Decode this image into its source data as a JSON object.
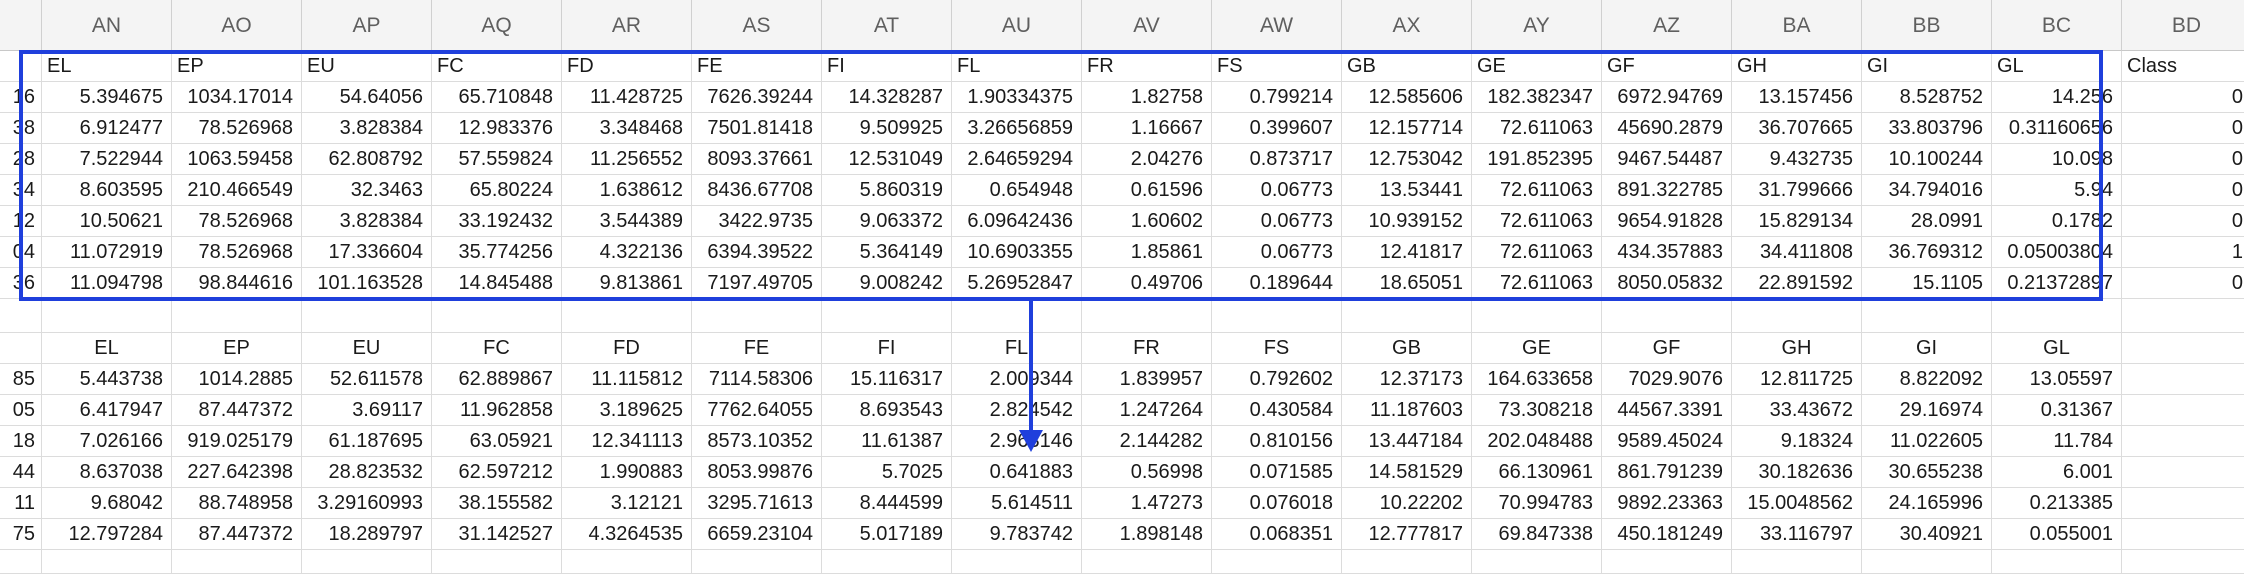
{
  "columns": [
    "AN",
    "AO",
    "AP",
    "AQ",
    "AR",
    "AS",
    "AT",
    "AU",
    "AV",
    "AW",
    "AX",
    "AY",
    "AZ",
    "BA",
    "BB",
    "BC",
    "BD"
  ],
  "top_table": {
    "headers": [
      "EL",
      "EP",
      "EU",
      "FC",
      "FD",
      "FE",
      "FI",
      "FL",
      "FR",
      "FS",
      "GB",
      "GE",
      "GF",
      "GH",
      "GI",
      "GL",
      "Class"
    ],
    "row_numbers": [
      "16",
      "38",
      "28",
      "34",
      "12",
      "04",
      "36"
    ],
    "rows": [
      [
        "5.394675",
        "1034.17014",
        "54.64056",
        "65.710848",
        "11.428725",
        "7626.39244",
        "14.328287",
        "1.90334375",
        "1.82758",
        "0.799214",
        "12.585606",
        "182.382347",
        "6972.94769",
        "13.157456",
        "8.528752",
        "14.256",
        "0"
      ],
      [
        "6.912477",
        "78.526968",
        "3.828384",
        "12.983376",
        "3.348468",
        "7501.81418",
        "9.509925",
        "3.26656859",
        "1.16667",
        "0.399607",
        "12.157714",
        "72.611063",
        "45690.2879",
        "36.707665",
        "33.803796",
        "0.31160656",
        "0"
      ],
      [
        "7.522944",
        "1063.59458",
        "62.808792",
        "57.559824",
        "11.256552",
        "8093.37661",
        "12.531049",
        "2.64659294",
        "2.04276",
        "0.873717",
        "12.753042",
        "191.852395",
        "9467.54487",
        "9.432735",
        "10.100244",
        "10.098",
        "0"
      ],
      [
        "8.603595",
        "210.466549",
        "32.3463",
        "65.80224",
        "1.638612",
        "8436.67708",
        "5.860319",
        "0.654948",
        "0.61596",
        "0.06773",
        "13.53441",
        "72.611063",
        "891.322785",
        "31.799666",
        "34.794016",
        "5.94",
        "0"
      ],
      [
        "10.50621",
        "78.526968",
        "3.828384",
        "33.192432",
        "3.544389",
        "3422.9735",
        "9.063372",
        "6.09642436",
        "1.60602",
        "0.06773",
        "10.939152",
        "72.611063",
        "9654.91828",
        "15.829134",
        "28.0991",
        "0.1782",
        "0"
      ],
      [
        "11.072919",
        "78.526968",
        "17.336604",
        "35.774256",
        "4.322136",
        "6394.39522",
        "5.364149",
        "10.6903355",
        "1.85861",
        "0.06773",
        "12.41817",
        "72.611063",
        "434.357883",
        "34.411808",
        "36.769312",
        "0.05003804",
        "1"
      ],
      [
        "11.094798",
        "98.844616",
        "101.163528",
        "14.845488",
        "9.813861",
        "7197.49705",
        "9.008242",
        "5.26952847",
        "0.49706",
        "0.189644",
        "18.65051",
        "72.611063",
        "8050.05832",
        "22.891592",
        "15.1105",
        "0.21372897",
        "0"
      ]
    ]
  },
  "bottom_table": {
    "headers": [
      "EL",
      "EP",
      "EU",
      "FC",
      "FD",
      "FE",
      "FI",
      "FL",
      "FR",
      "FS",
      "GB",
      "GE",
      "GF",
      "GH",
      "GI",
      "GL"
    ],
    "row_numbers": [
      "85",
      "05",
      "18",
      "44",
      "11",
      "75"
    ],
    "rows": [
      [
        "5.443738",
        "1014.2885",
        "52.611578",
        "62.889867",
        "11.115812",
        "7114.58306",
        "15.116317",
        "2.009344",
        "1.839957",
        "0.792602",
        "12.37173",
        "164.633658",
        "7029.9076",
        "12.811725",
        "8.822092",
        "13.05597"
      ],
      [
        "6.417947",
        "87.447372",
        "3.69117",
        "11.962858",
        "3.189625",
        "7762.64055",
        "8.693543",
        "2.824542",
        "1.247264",
        "0.430584",
        "11.187603",
        "73.308218",
        "44567.3391",
        "33.43672",
        "29.16974",
        "0.31367"
      ],
      [
        "7.026166",
        "919.025179",
        "61.187695",
        "63.05921",
        "12.341113",
        "8573.10352",
        "11.61387",
        "2.963146",
        "2.144282",
        "0.810156",
        "13.447184",
        "202.048488",
        "9589.45024",
        "9.18324",
        "11.022605",
        "11.784"
      ],
      [
        "8.637038",
        "227.642398",
        "28.823532",
        "62.597212",
        "1.990883",
        "8053.99876",
        "5.7025",
        "0.641883",
        "0.56998",
        "0.071585",
        "14.581529",
        "66.130961",
        "861.791239",
        "30.182636",
        "30.655238",
        "6.001"
      ],
      [
        "9.68042",
        "88.748958",
        "3.29160993",
        "38.155582",
        "3.12121",
        "3295.71613",
        "8.444599",
        "5.614511",
        "1.47273",
        "0.076018",
        "10.22202",
        "70.994783",
        "9892.23363",
        "15.0048562",
        "24.165996",
        "0.213385"
      ],
      [
        "12.797284",
        "87.447372",
        "18.289797",
        "31.142527",
        "4.3264535",
        "6659.23104",
        "5.017189",
        "9.783742",
        "1.898148",
        "0.068351",
        "12.777817",
        "69.847338",
        "450.181249",
        "33.116797",
        "30.40921",
        "0.055001"
      ]
    ]
  },
  "colors": {
    "selection": "#1f3fdc",
    "arrow": "#1f3fdc",
    "header_bg": "#f4f4f4",
    "grid": "#dcdcdc"
  }
}
